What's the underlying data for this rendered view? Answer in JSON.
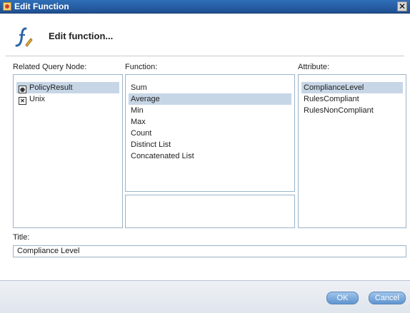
{
  "window": {
    "title": "Edit Function",
    "close_symbol": "✕"
  },
  "header": {
    "heading": "Edit function..."
  },
  "related_query_node": {
    "label": "Related Query Node:",
    "items": [
      {
        "label": "PolicyResult",
        "icon": "policy-result-icon",
        "selected": true
      },
      {
        "label": "Unix",
        "icon": "unix-icon",
        "selected": false
      }
    ]
  },
  "function": {
    "label": "Function:",
    "items": [
      "Sum",
      "Average",
      "Min",
      "Max",
      "Count",
      "Distinct List",
      "Concatenated List"
    ],
    "selected": "Average"
  },
  "attribute": {
    "label": "Attribute:",
    "items": [
      "ComplianceLevel",
      "RulesCompliant",
      "RulesNonCompliant"
    ],
    "selected": "ComplianceLevel"
  },
  "title_field": {
    "label": "Title:",
    "value": "Compliance Level"
  },
  "buttons": {
    "ok": "OK",
    "cancel": "Cancel"
  },
  "colors": {
    "titlebar": "#1f4f92",
    "selection": "#c7d6e6",
    "button": "#5f95d0"
  }
}
